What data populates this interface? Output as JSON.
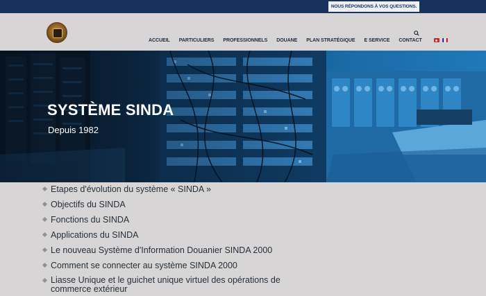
{
  "topbar": {
    "button_label": "NOUS RÉPONDONS À VOS QUESTIONS."
  },
  "header": {
    "logo_icon": "customs-emblem-icon",
    "search_icon": "search-icon",
    "nav": [
      {
        "label": "ACCUEIL"
      },
      {
        "label": "PARTICULIERS"
      },
      {
        "label": "PROFESSIONNELS"
      },
      {
        "label": "DOUANE"
      },
      {
        "label": "PLAN STRATÉGIQUE"
      },
      {
        "label": "E SERVICE"
      },
      {
        "label": "CONTACT"
      }
    ],
    "flags": [
      "tunisia-flag-icon",
      "france-flag-icon"
    ]
  },
  "hero": {
    "title": "SYSTÈME SINDA",
    "subtitle": "Depuis 1982"
  },
  "links": [
    {
      "label": "Etapes d'évolution du système « SINDA »"
    },
    {
      "label": "Objectifs du SINDA"
    },
    {
      "label": "Fonctions du SINDA"
    },
    {
      "label": "Applications du SINDA"
    },
    {
      "label": "Le nouveau Système d'Information Douanier SINDA 2000"
    },
    {
      "label": "Comment se connecter au système SINDA 2000"
    },
    {
      "label": "Liasse Unique et le guichet unique virtuel des opérations de commerce extérieur"
    }
  ],
  "colors": {
    "topbar": "#17325d",
    "background": "#d7d5d5",
    "nav_text": "#1d2a3c",
    "link_text": "#27303a",
    "hero_blue": "#1a6aa6"
  }
}
